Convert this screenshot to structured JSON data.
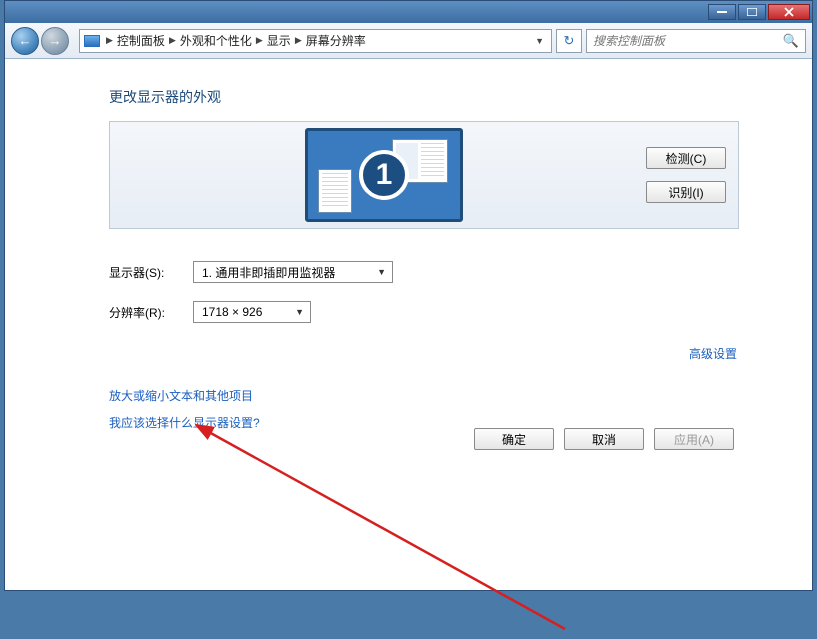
{
  "titlebar": {
    "min_tip": "最小化",
    "max_tip": "最大化",
    "close_tip": "关闭"
  },
  "breadcrumb": {
    "itemA": "控制面板",
    "itemB": "外观和个性化",
    "itemC": "显示",
    "itemD": "屏幕分辨率"
  },
  "search": {
    "placeholder": "搜索控制面板"
  },
  "heading": "更改显示器的外观",
  "preview": {
    "monitorNumber": "1",
    "detect": "检测(C)",
    "identify": "识别(I)"
  },
  "form": {
    "monitorLabel": "显示器(S):",
    "monitorValue": "1. 通用非即插即用监视器",
    "resLabel": "分辨率(R):",
    "resValue": "1718 × 926"
  },
  "advanced": "高级设置",
  "linkA": "放大或缩小文本和其他项目",
  "linkB": "我应该选择什么显示器设置?",
  "buttons": {
    "ok": "确定",
    "cancel": "取消",
    "apply": "应用(A)"
  }
}
